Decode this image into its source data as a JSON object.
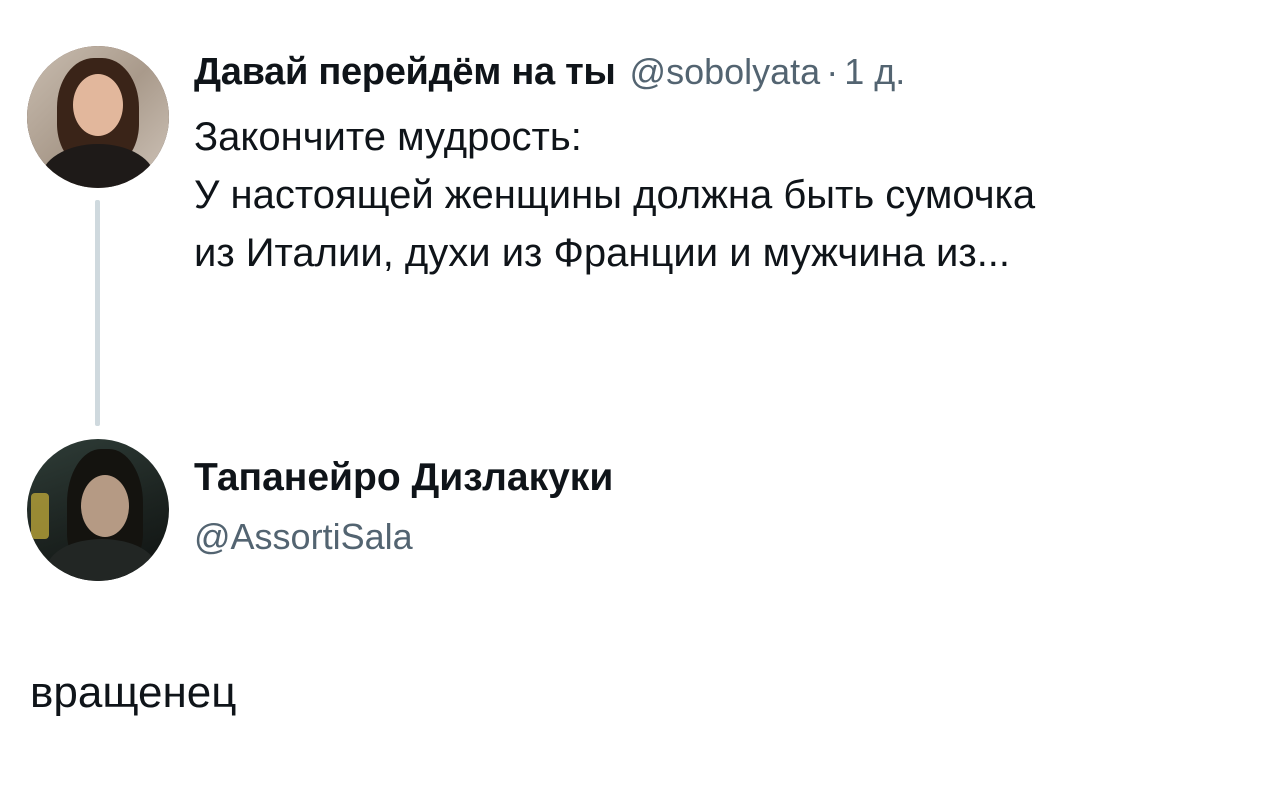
{
  "original_tweet": {
    "display_name": "Давай перейдём на ты",
    "handle": "@sobolyata",
    "separator": "·",
    "time": "1 д.",
    "text_lines": [
      "Закончите мудрость:",
      "У настоящей женщины должна быть сумочка",
      "из Италии, духи из Франции и мужчина из..."
    ]
  },
  "reply": {
    "display_name": "Тапанейро Дизлакуки",
    "handle": "@AssortiSala",
    "text": "вращенец"
  },
  "colors": {
    "text_primary": "#0f1419",
    "text_secondary": "#536471",
    "thread_line": "#cfd9de",
    "background": "#ffffff"
  }
}
